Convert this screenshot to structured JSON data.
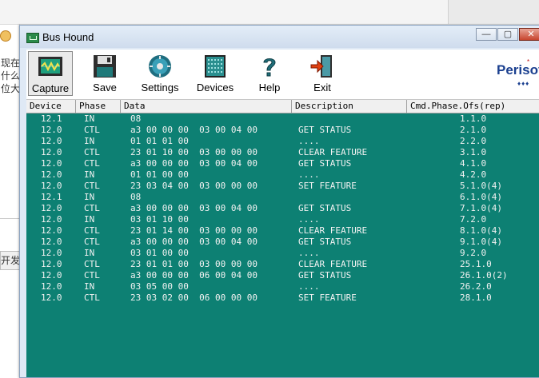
{
  "background": {
    "texts": [
      "现在",
      "什么",
      "位大"
    ],
    "button_label": "开发人"
  },
  "window": {
    "title": "Bus Hound",
    "controls": {
      "min": "—",
      "max": "▢",
      "close": "✕"
    }
  },
  "toolbar": {
    "buttons": [
      {
        "label": "Capture",
        "icon": "capture-icon",
        "selected": true
      },
      {
        "label": "Save",
        "icon": "floppy-icon"
      },
      {
        "label": "Settings",
        "icon": "gear-icon"
      },
      {
        "label": "Devices",
        "icon": "device-chip-icon"
      },
      {
        "label": "Help",
        "icon": "question-icon"
      },
      {
        "label": "Exit",
        "icon": "exit-door-icon"
      }
    ],
    "brand": "Perisof",
    "brand_dots": "♦♦♦"
  },
  "columns": [
    "Device",
    "Phase",
    "Data",
    "Description",
    "Cmd.Phase.Ofs(rep)"
  ],
  "rows": [
    {
      "device": "12.1",
      "phase": "IN",
      "data": "08",
      "desc": "",
      "cmd": "1.1.0"
    },
    {
      "device": "12.0",
      "phase": "CTL",
      "data": "a3 00 00 00  03 00 04 00",
      "desc": "GET STATUS",
      "cmd": "2.1.0"
    },
    {
      "device": "12.0",
      "phase": "IN",
      "data": "01 01 01 00",
      "desc": "....",
      "cmd": "2.2.0"
    },
    {
      "device": "12.0",
      "phase": "CTL",
      "data": "23 01 10 00  03 00 00 00",
      "desc": "CLEAR FEATURE",
      "cmd": "3.1.0"
    },
    {
      "device": "12.0",
      "phase": "CTL",
      "data": "a3 00 00 00  03 00 04 00",
      "desc": "GET STATUS",
      "cmd": "4.1.0"
    },
    {
      "device": "12.0",
      "phase": "IN",
      "data": "01 01 00 00",
      "desc": "....",
      "cmd": "4.2.0"
    },
    {
      "device": "12.0",
      "phase": "CTL",
      "data": "23 03 04 00  03 00 00 00",
      "desc": "SET FEATURE",
      "cmd": "5.1.0(4)"
    },
    {
      "device": "12.1",
      "phase": "IN",
      "data": "08",
      "desc": "",
      "cmd": "6.1.0(4)"
    },
    {
      "device": "12.0",
      "phase": "CTL",
      "data": "a3 00 00 00  03 00 04 00",
      "desc": "GET STATUS",
      "cmd": "7.1.0(4)"
    },
    {
      "device": "12.0",
      "phase": "IN",
      "data": "03 01 10 00",
      "desc": "....",
      "cmd": "7.2.0"
    },
    {
      "device": "12.0",
      "phase": "CTL",
      "data": "23 01 14 00  03 00 00 00",
      "desc": "CLEAR FEATURE",
      "cmd": "8.1.0(4)"
    },
    {
      "device": "12.0",
      "phase": "CTL",
      "data": "a3 00 00 00  03 00 04 00",
      "desc": "GET STATUS",
      "cmd": "9.1.0(4)"
    },
    {
      "device": "12.0",
      "phase": "IN",
      "data": "03 01 00 00",
      "desc": "....",
      "cmd": "9.2.0"
    },
    {
      "device": "12.0",
      "phase": "CTL",
      "data": "23 01 01 00  03 00 00 00",
      "desc": "CLEAR FEATURE",
      "cmd": "25.1.0"
    },
    {
      "device": "12.0",
      "phase": "CTL",
      "data": "a3 00 00 00  06 00 04 00",
      "desc": "GET STATUS",
      "cmd": "26.1.0(2)"
    },
    {
      "device": "12.0",
      "phase": "IN",
      "data": "03 05 00 00",
      "desc": "....",
      "cmd": "26.2.0"
    },
    {
      "device": "12.0",
      "phase": "CTL",
      "data": "23 03 02 00  06 00 00 00",
      "desc": "SET FEATURE",
      "cmd": "28.1.0"
    }
  ]
}
